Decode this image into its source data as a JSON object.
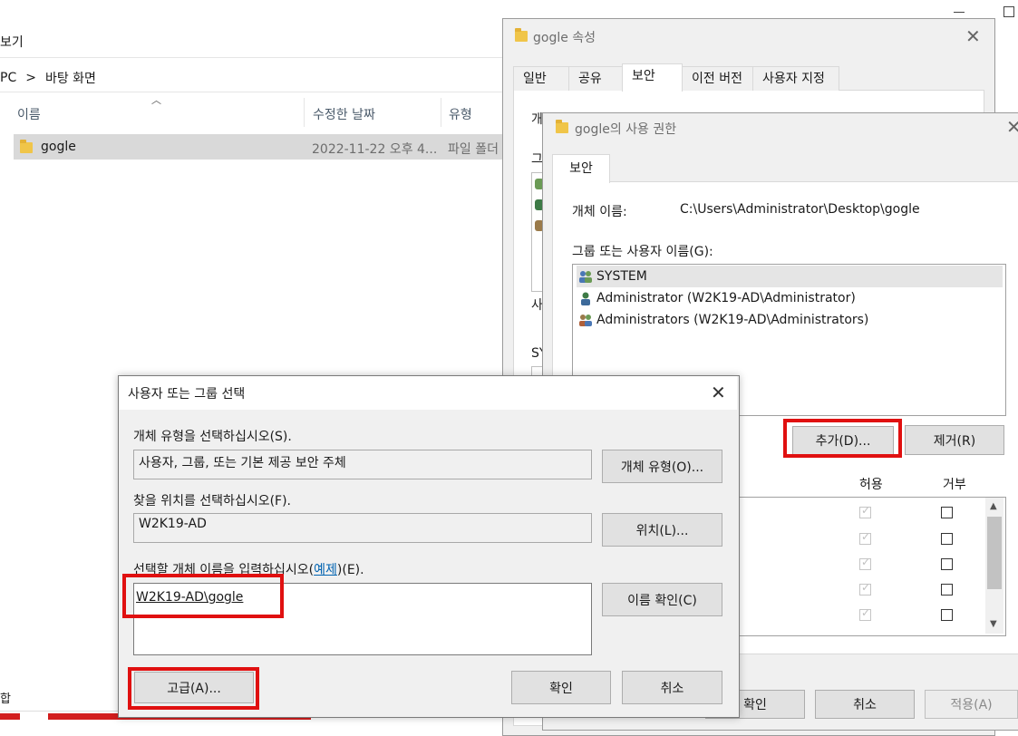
{
  "screen": {},
  "explorer": {
    "menu_view": "보기",
    "path_pc": "PC",
    "path_sep": ">",
    "path_desktop": "바탕 화면",
    "columns": {
      "name": "이름",
      "modified": "수정한 날짜",
      "type": "유형"
    },
    "rows": [
      {
        "name": "gogle",
        "modified": "2022-11-22 오후 4...",
        "type": "파일 폴더"
      }
    ],
    "bottom_char": "합"
  },
  "properties": {
    "title": "gogle 속성",
    "tabs": [
      "일반",
      "공유",
      "보안",
      "이전 버전",
      "사용자 지정"
    ],
    "active_tab": "보안",
    "peek_1": "개",
    "peek_2": "그",
    "peek_3": "사",
    "peek_4": "SY"
  },
  "permissions": {
    "title": "gogle의 사용 권한",
    "tab": "보안",
    "object_label": "개체 이름:",
    "object_path": "C:\\Users\\Administrator\\Desktop\\gogle",
    "group_label": "그룹 또는 사용자 이름(G):",
    "groups": [
      "SYSTEM",
      "Administrator (W2K19-AD\\Administrator)",
      "Administrators (W2K19-AD\\Administrators)"
    ],
    "add_button": "추가(D)...",
    "remove_button": "제거(R)",
    "allow_header": "허용",
    "deny_header": "거부",
    "ok_button": "확인",
    "cancel_button": "취소",
    "apply_button": "적용(A)"
  },
  "select_dialog": {
    "title": "사용자 또는 그룹 선택",
    "object_type_label": "개체 유형을 선택하십시오(S).",
    "object_type_value": "사용자, 그룹, 또는 기본 제공 보안 주체",
    "object_type_button": "개체 유형(O)...",
    "location_label": "찾을 위치를 선택하십시오(F).",
    "location_value": "W2K19-AD",
    "location_button": "위치(L)...",
    "enter_label_prefix": "선택할 개체 이름을 입력하십시오(",
    "enter_label_link": "예제",
    "enter_label_suffix": ")(E).",
    "name_value": "W2K19-AD\\gogle",
    "check_names_button": "이름 확인(C)",
    "advanced_button": "고급(A)...",
    "ok_button": "확인",
    "cancel_button": "취소"
  },
  "colors": {
    "highlight_red": "#e01010",
    "link_blue": "#0063b1",
    "folder_yellow": "#f0c549"
  }
}
